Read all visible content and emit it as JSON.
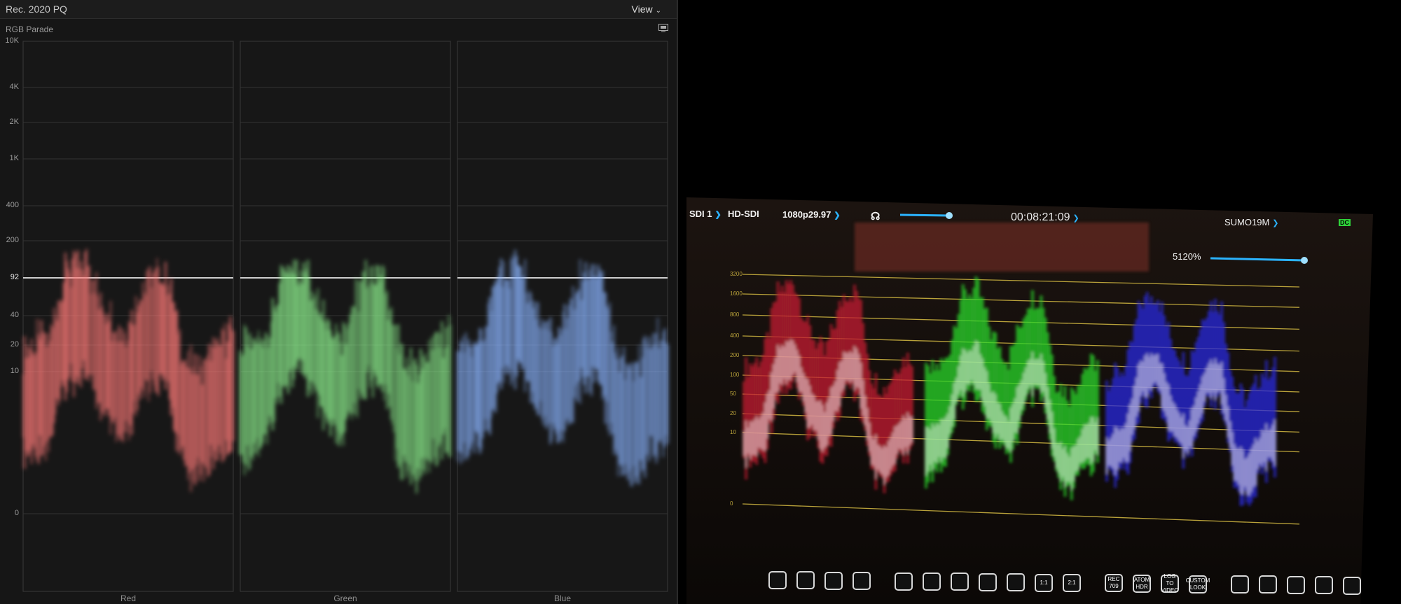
{
  "scope_panel": {
    "title": "Rec. 2020 PQ",
    "view_label": "View",
    "scope_type": "RGB Parade",
    "y_ticks": [
      "10K",
      "4K",
      "2K",
      "1K",
      "400",
      "200",
      "92",
      "40",
      "20",
      "10",
      "0"
    ],
    "highlighted_tick": "92",
    "channels": [
      {
        "label": "Red",
        "color": "#ff7a78"
      },
      {
        "label": "Green",
        "color": "#8df08d"
      },
      {
        "label": "Blue",
        "color": "#8ab4ff"
      }
    ]
  },
  "monitor": {
    "input": "SDI 1",
    "signal": "HD-SDI",
    "format": "1080p29.97",
    "timecode": "00:08:21:09",
    "clip_name": "SUMO19M",
    "zoom": "5120%",
    "dc_badge": "DC",
    "scale_labels": [
      "3200",
      "1600",
      "800",
      "400",
      "200",
      "100",
      "50",
      "20",
      "10",
      "0"
    ],
    "toolbar": [
      {
        "icon": "waveform-icon",
        "label": ""
      },
      {
        "icon": "rgb-parade-icon",
        "label": ""
      },
      {
        "icon": "focus-peaking-icon",
        "label": ""
      },
      {
        "icon": "zebra-icon",
        "label": ""
      },
      {
        "icon": "false-color-icon",
        "label": ""
      },
      {
        "icon": "striped-icon",
        "label": ""
      },
      {
        "icon": "color-bars-icon",
        "label": ""
      },
      {
        "icon": "lock-icon",
        "label": ""
      },
      {
        "icon": "frame-guide-icon",
        "label": ""
      },
      {
        "icon": "one-to-one-icon",
        "label": "1:1"
      },
      {
        "icon": "two-to-one-icon",
        "label": "2:1"
      },
      {
        "icon": "rec709-icon",
        "label": "REC 709"
      },
      {
        "icon": "atom-hdr-icon",
        "label": "ATOM HDR"
      },
      {
        "icon": "log-to-video-icon",
        "label": "LOG TO VIDEO"
      },
      {
        "icon": "custom-look-icon",
        "label": "CUSTOM LOOK"
      },
      {
        "icon": "no-entry-icon",
        "label": ""
      },
      {
        "icon": "crosshair-icon",
        "label": ""
      },
      {
        "icon": "notes-icon",
        "label": ""
      },
      {
        "icon": "gear-icon",
        "label": ""
      },
      {
        "icon": "atomos-logo-icon",
        "label": ""
      }
    ]
  }
}
